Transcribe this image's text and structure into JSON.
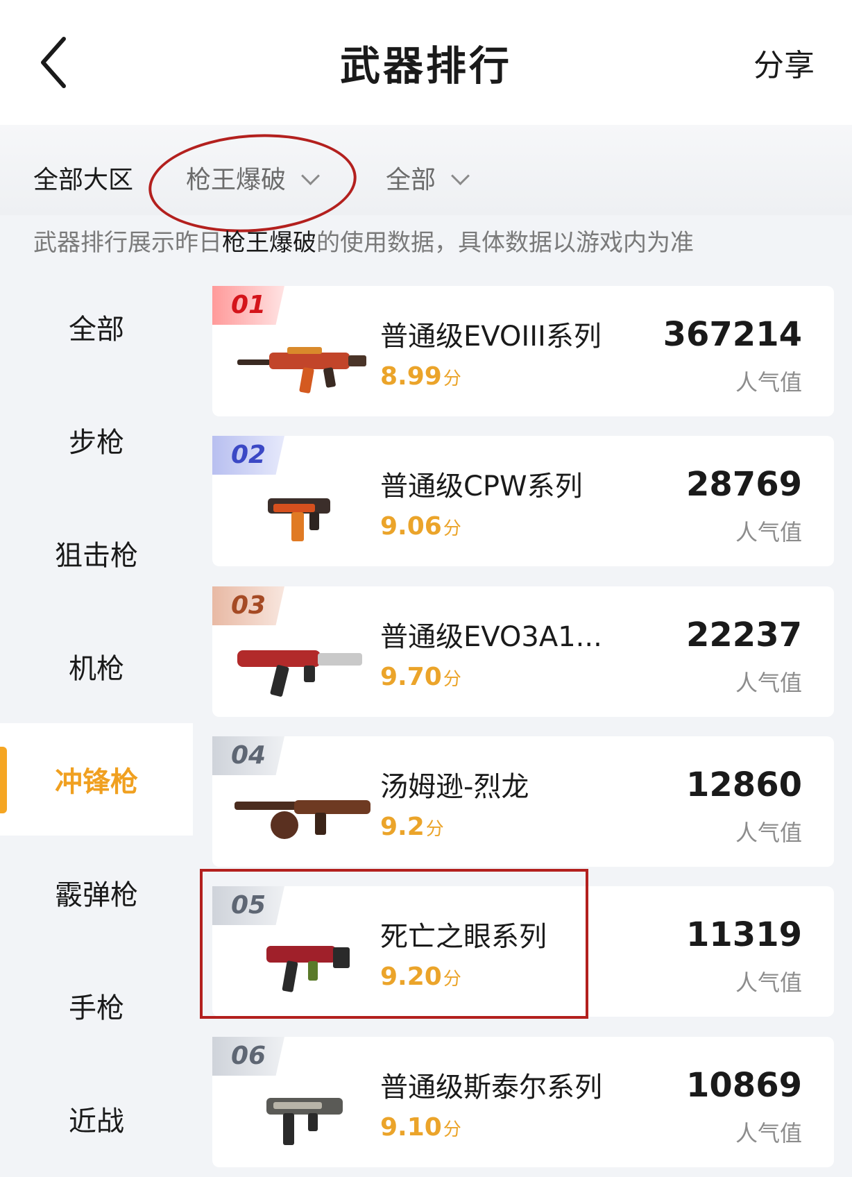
{
  "header": {
    "title": "武器排行",
    "share_label": "分享"
  },
  "filters": {
    "region": "全部大区",
    "mode": "枪王爆破",
    "subset": "全部"
  },
  "notice": {
    "prefix": "武器排行展示昨日",
    "mode": "枪王爆破",
    "suffix": "的使用数据，具体数据以游戏内为准"
  },
  "sidebar": {
    "items": [
      {
        "label": "全部"
      },
      {
        "label": "步枪"
      },
      {
        "label": "狙击枪"
      },
      {
        "label": "机枪"
      },
      {
        "label": "冲锋枪",
        "active": true
      },
      {
        "label": "霰弹枪"
      },
      {
        "label": "手枪"
      },
      {
        "label": "近战"
      }
    ]
  },
  "weapons": [
    {
      "rank": "01",
      "name": "普通级EVOIII系列",
      "score": "8.99",
      "unit": "分",
      "popularity": "367214",
      "pop_label": "人气值"
    },
    {
      "rank": "02",
      "name": "普通级CPW系列",
      "score": "9.06",
      "unit": "分",
      "popularity": "28769",
      "pop_label": "人气值"
    },
    {
      "rank": "03",
      "name": "普通级EVO3A1...",
      "score": "9.70",
      "unit": "分",
      "popularity": "22237",
      "pop_label": "人气值"
    },
    {
      "rank": "04",
      "name": "汤姆逊-烈龙",
      "score": "9.2",
      "unit": "分",
      "popularity": "12860",
      "pop_label": "人气值"
    },
    {
      "rank": "05",
      "name": "死亡之眼系列",
      "score": "9.20",
      "unit": "分",
      "popularity": "11319",
      "pop_label": "人气值"
    },
    {
      "rank": "06",
      "name": "普通级斯泰尔系列",
      "score": "9.10",
      "unit": "分",
      "popularity": "10869",
      "pop_label": "人气值"
    }
  ],
  "colors": {
    "accent": "#f5a623",
    "score": "#eba42a",
    "annotation": "#b3201e"
  }
}
